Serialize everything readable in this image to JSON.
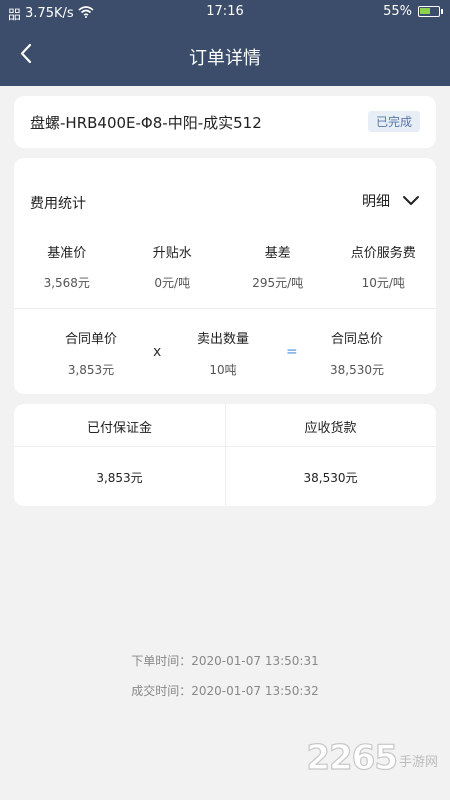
{
  "status_bar": {
    "carrier_glyph": "㗊",
    "speed": "3.75K/s",
    "time": "17:16",
    "battery": "55%",
    "battery_level": 0.55,
    "icons": [
      "wifi-icon",
      "battery-icon"
    ]
  },
  "nav": {
    "title": "订单详情",
    "back_icon": "chevron-left-icon"
  },
  "product": {
    "name": "盘螺-HRB400E-Φ8-中阳-成实512",
    "status": "已完成"
  },
  "fee_stats": {
    "title": "费用统计",
    "detail_label": "明细",
    "items": [
      {
        "label": "基准价",
        "value": "3,568元"
      },
      {
        "label": "升贴水",
        "value": "0元/吨"
      },
      {
        "label": "基差",
        "value": "295元/吨"
      },
      {
        "label": "点价服务费",
        "value": "10元/吨"
      }
    ],
    "calc": {
      "unit_price_label": "合同单价",
      "unit_price_value": "3,853元",
      "times_symbol": "x",
      "quantity_label": "卖出数量",
      "quantity_value": "10吨",
      "equals_symbol": "=",
      "total_label": "合同总价",
      "total_value": "38,530元"
    }
  },
  "payment": {
    "deposit_label": "已付保证金",
    "deposit_value": "3,853元",
    "receivable_label": "应收货款",
    "receivable_value": "38,530元"
  },
  "times": {
    "order_time": "下单时间：2020-01-07 13:50:31",
    "deal_time": "成交时间：2020-01-07 13:50:32"
  },
  "watermark": {
    "number": "2265",
    "text": "手游网"
  },
  "colors": {
    "header_bg": "#3b4d6a",
    "page_bg": "#f2f2f2",
    "badge_bg": "#e8eef6",
    "badge_text": "#5676a8",
    "equals_color": "#4a90e2"
  }
}
